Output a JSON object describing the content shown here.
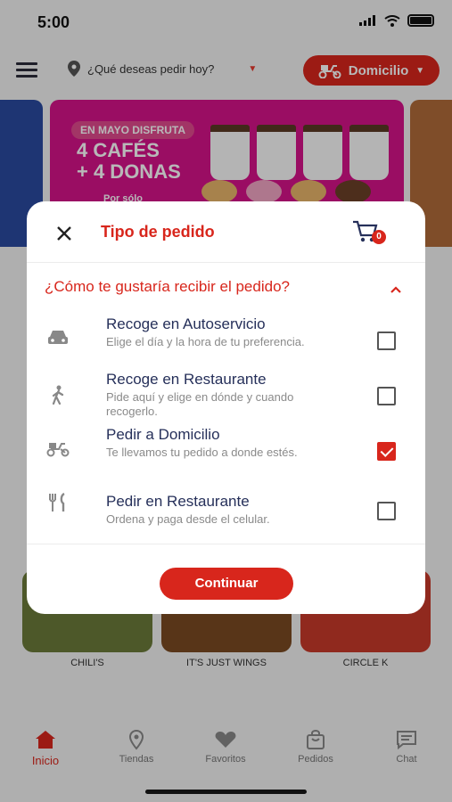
{
  "status": {
    "time": "5:00"
  },
  "header": {
    "location_placeholder": "¿Qué deseas pedir hoy?",
    "mode_button": "Domicilio"
  },
  "banner": {
    "pill": "EN MAYO DISFRUTA",
    "line1": "4 CAFÉS",
    "line2": "+ 4 DONAS",
    "price_label": "Por sólo"
  },
  "cards": [
    {
      "label": "CHILI'S"
    },
    {
      "label": "IT'S JUST WINGS"
    },
    {
      "label": "CIRCLE K"
    }
  ],
  "bottom_nav": {
    "items": [
      {
        "label": "Inicio",
        "icon": "home-icon",
        "active": true
      },
      {
        "label": "Tiendas",
        "icon": "location-pin-icon"
      },
      {
        "label": "Favoritos",
        "icon": "heart-icon"
      },
      {
        "label": "Pedidos",
        "icon": "bag-icon"
      },
      {
        "label": "Chat",
        "icon": "chat-icon"
      }
    ]
  },
  "modal": {
    "title": "Tipo de pedido",
    "cart_count": "0",
    "question": "¿Cómo te gustaría recibir el pedido?",
    "options": [
      {
        "title": "Recoge en Autoservicio",
        "desc": "Elige el día y la hora de tu preferencia.",
        "icon": "car-icon",
        "checked": false
      },
      {
        "title": "Recoge en Restaurante",
        "desc": "Pide aquí y elige en dónde y cuando recogerlo.",
        "icon": "walking-person-icon",
        "checked": false
      },
      {
        "title": "Pedir a Domicilio",
        "desc": "Te llevamos tu pedido a donde estés.",
        "icon": "scooter-icon",
        "checked": true
      },
      {
        "title": "Pedir en Restaurante",
        "desc": "Ordena y paga desde el celular.",
        "icon": "fork-knife-icon",
        "checked": false
      }
    ],
    "continue_label": "Continuar"
  },
  "colors": {
    "accent": "#d8261c",
    "option_title": "#26305a"
  }
}
